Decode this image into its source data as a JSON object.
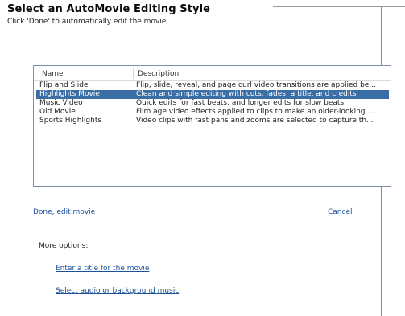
{
  "window": {
    "title": "Select an AutoMovie Editing Style",
    "subtitle": "Click 'Done' to automatically edit the movie."
  },
  "list": {
    "columns": {
      "name": "Name",
      "description": "Description"
    },
    "rows": [
      {
        "name": "Flip and Slide",
        "description": "Flip, slide, reveal, and page curl video transitions are applied be..."
      },
      {
        "name": "Highlights Movie",
        "description": "Clean and simple editing with cuts, fades, a title, and credits",
        "selected": true
      },
      {
        "name": "Music Video",
        "description": "Quick edits for fast beats, and longer edits for slow beats"
      },
      {
        "name": "Old Movie",
        "description": "Film age video effects applied to clips to make an older-looking ..."
      },
      {
        "name": "Sports Highlights",
        "description": "Video clips with fast pans and zooms are selected to capture th..."
      }
    ]
  },
  "actions": {
    "done": "Done, edit movie",
    "cancel": "Cancel"
  },
  "more_options": {
    "label": "More options:",
    "title_link": "Enter a title for the movie",
    "audio_link": "Select audio or background music"
  },
  "colors": {
    "selection": "#3a6ea5",
    "link": "#1a4f9a"
  }
}
